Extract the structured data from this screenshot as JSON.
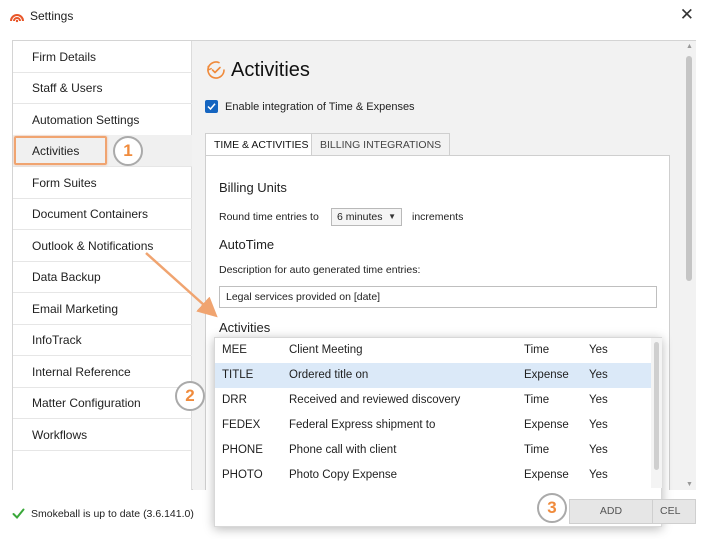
{
  "window": {
    "title": "Settings",
    "close_glyph": "✕"
  },
  "sidebar": {
    "items": [
      {
        "label": "Firm Details"
      },
      {
        "label": "Staff & Users"
      },
      {
        "label": "Automation Settings"
      },
      {
        "label": "Activities"
      },
      {
        "label": "Form Suites"
      },
      {
        "label": "Document Containers"
      },
      {
        "label": "Outlook & Notifications"
      },
      {
        "label": "Data Backup"
      },
      {
        "label": "Email Marketing"
      },
      {
        "label": "InfoTrack"
      },
      {
        "label": "Internal Reference"
      },
      {
        "label": "Matter Configuration"
      },
      {
        "label": "Workflows"
      }
    ],
    "selected": "Activities"
  },
  "main": {
    "heading": "Activities",
    "heading_icon": "activities-check-icon",
    "enable_checkbox": {
      "label": "Enable integration of Time & Expenses",
      "checked": true
    },
    "tabs": [
      {
        "label": "TIME & ACTIVITIES"
      },
      {
        "label": "BILLING INTEGRATIONS"
      }
    ],
    "billing_units": {
      "title": "Billing Units",
      "prefix": "Round time entries to",
      "dropdown_value": "6 minutes",
      "suffix": "increments"
    },
    "autotime": {
      "title": "AutoTime",
      "description_label": "Description for auto generated time entries:",
      "description_value": "Legal services provided on [date]"
    },
    "activities_title": "Activities"
  },
  "activities_list": {
    "rows": [
      {
        "code": "MEE",
        "description": "Client Meeting",
        "type": "Time",
        "billable": "Yes"
      },
      {
        "code": "TITLE",
        "description": "Ordered title on",
        "type": "Expense",
        "billable": "Yes"
      },
      {
        "code": "DRR",
        "description": "Received and reviewed discovery",
        "type": "Time",
        "billable": "Yes"
      },
      {
        "code": "FEDEX",
        "description": "Federal Express shipment to",
        "type": "Expense",
        "billable": "Yes"
      },
      {
        "code": "PHONE",
        "description": "Phone call with client",
        "type": "Time",
        "billable": "Yes"
      },
      {
        "code": "PHOTO",
        "description": "Photo Copy Expense",
        "type": "Expense",
        "billable": "Yes"
      }
    ],
    "selected_index": 1,
    "add_label": "ADD"
  },
  "footer": {
    "status": "Smokeball is up to date (3.6.141.0)",
    "cancel_label": "CEL"
  },
  "annotations": {
    "badges": [
      "1",
      "2",
      "3"
    ],
    "color": "#f0a470"
  },
  "colors": {
    "accent": "#1565c0",
    "logo": "#e8572a",
    "selected_row": "#dbe9f8",
    "status_check": "#3aa83a",
    "heading_icon": "#f08b3c"
  }
}
